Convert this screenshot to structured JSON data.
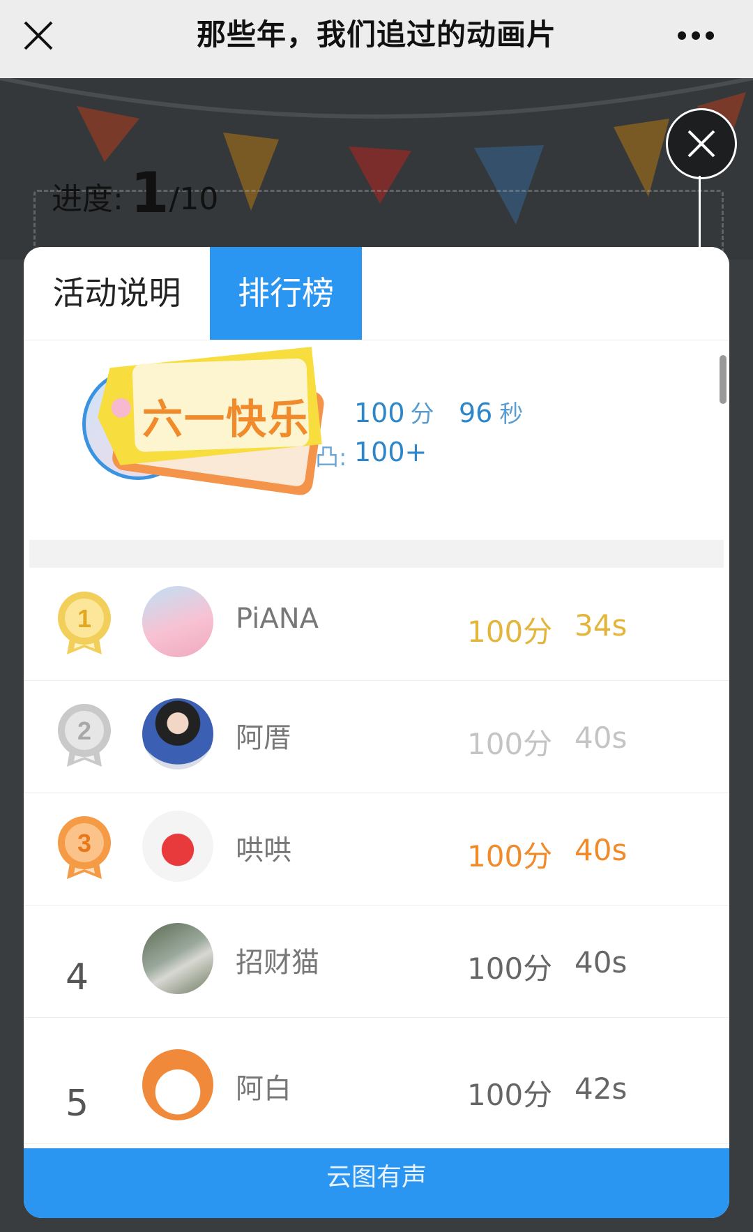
{
  "topbar": {
    "title": "那些年，我们追过的动画片",
    "close_icon": "close-icon",
    "more_icon": "more-icon"
  },
  "background": {
    "progress_label": "进度:",
    "progress_current": "1",
    "progress_total": "/10"
  },
  "modal": {
    "tabs": [
      {
        "label": "活动说明",
        "active": false
      },
      {
        "label": "排行榜",
        "active": true
      }
    ],
    "my_record": {
      "label_score_fragment": ":",
      "label_rank_fragment": "凸:",
      "score": "100",
      "score_unit": "分",
      "time": "96",
      "time_unit": "秒",
      "rank": "100+"
    },
    "tag_text": "六一快乐",
    "ranking": [
      {
        "rank": "1",
        "name": "PiANA",
        "score": "100分",
        "time": "34s",
        "medal": "gold-medal-icon",
        "color": "#e3b53a"
      },
      {
        "rank": "2",
        "name": "阿厝",
        "score": "100分",
        "time": "40s",
        "medal": "silver-medal-icon",
        "color": "#c4c4c4"
      },
      {
        "rank": "3",
        "name": "哄哄",
        "score": "100分",
        "time": "40s",
        "medal": "bronze-medal-icon",
        "color": "#f08a2a"
      },
      {
        "rank": "4",
        "name": "招财猫",
        "score": "100分",
        "time": "40s",
        "medal": "",
        "color": "#666666"
      },
      {
        "rank": "5",
        "name": "阿白",
        "score": "100分",
        "time": "42s",
        "medal": "",
        "color": "#666666"
      }
    ],
    "footer_text": "云图有声"
  },
  "colors": {
    "accent": "#2b95f2",
    "gold": "#e3b53a",
    "silver": "#c4c4c4",
    "bronze": "#f08a2a"
  }
}
